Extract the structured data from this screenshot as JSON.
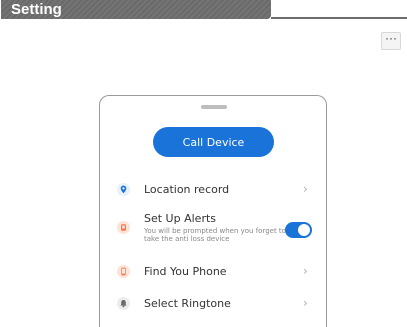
{
  "header": {
    "title": "Setting"
  },
  "toolbar": {
    "more_label": "···"
  },
  "phone": {
    "call_button_label": "Call Device",
    "items": [
      {
        "label": "Location record",
        "icon": "location-pin-icon",
        "icon_color": "#1a73d9"
      },
      {
        "label": "Set Up Alerts",
        "icon": "alert-device-icon",
        "icon_color": "#f07a48",
        "subtitle": "You will be prompted when you forget to take the anti loss device",
        "toggle_on": true
      },
      {
        "label": "Find You Phone",
        "icon": "phone-icon",
        "icon_color": "#f07a48"
      },
      {
        "label": "Select Ringtone",
        "icon": "bell-icon",
        "icon_color": "#8a8a8a"
      }
    ],
    "chevron": "›"
  },
  "colors": {
    "accent": "#1a73d9",
    "header_bg": "#6e6e6e",
    "orange": "#f07a48"
  }
}
